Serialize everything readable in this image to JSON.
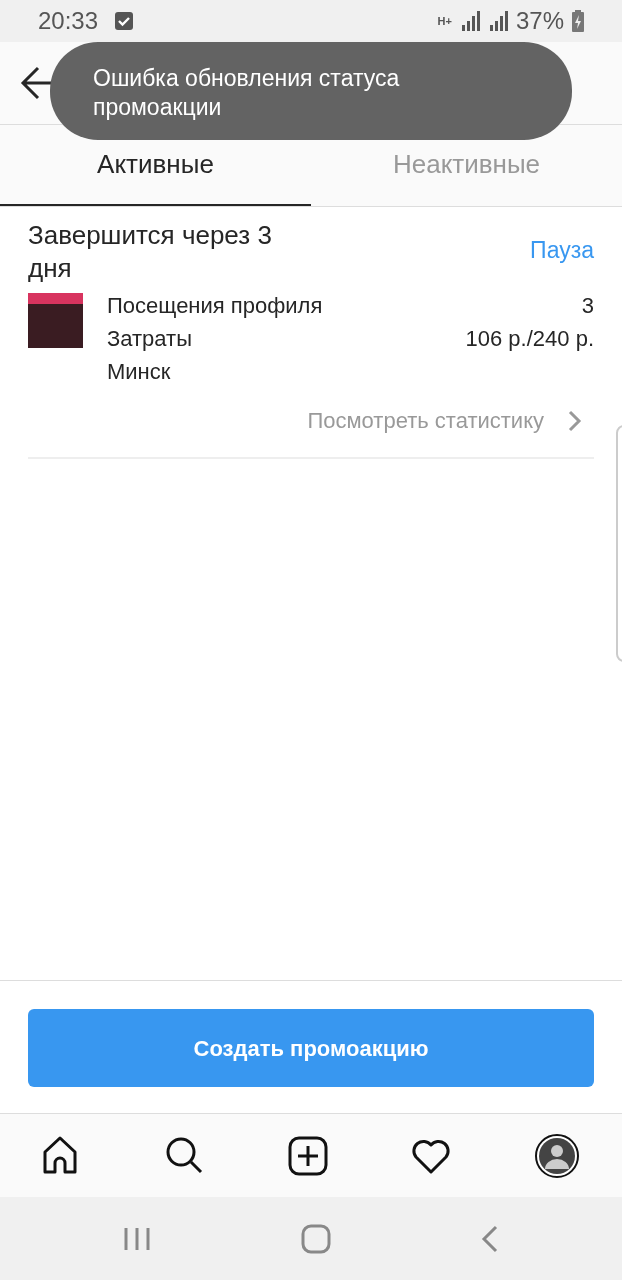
{
  "status_bar": {
    "time": "20:33",
    "network": "H+",
    "battery": "37%"
  },
  "toast": {
    "message": "Ошибка обновления статуса промоакции"
  },
  "tabs": [
    {
      "label": "Активные",
      "selected": true
    },
    {
      "label": "Неактивные",
      "selected": false
    }
  ],
  "promotion": {
    "ends": "Завершится через 3 дня",
    "action": "Пауза",
    "stats": [
      {
        "label": "Посещения профиля",
        "value": "3"
      },
      {
        "label": "Затраты",
        "value": "106 р./240 р."
      },
      {
        "label": "Минск"
      }
    ],
    "link": "Посмотреть статистику"
  },
  "create_button": "Создать промоакцию",
  "bottom_nav": [
    {
      "kind": "home"
    },
    {
      "kind": "search"
    },
    {
      "kind": "add"
    },
    {
      "kind": "heart"
    },
    {
      "kind": "profile"
    }
  ]
}
